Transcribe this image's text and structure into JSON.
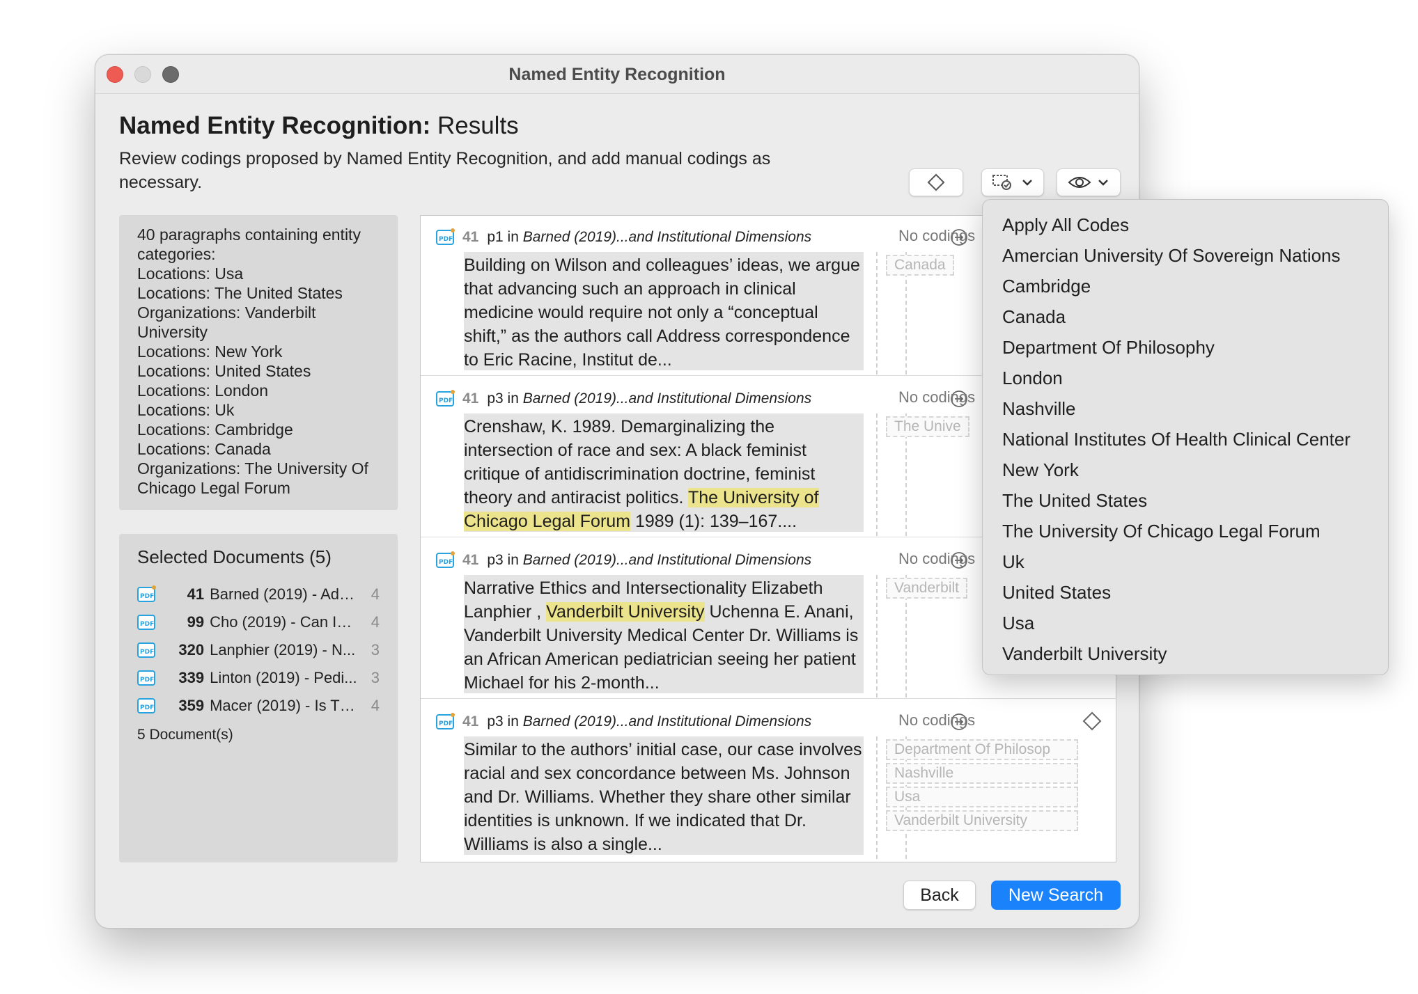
{
  "window": {
    "title": "Named Entity Recognition"
  },
  "header": {
    "title_bold": "Named Entity Recognition:",
    "title_rest": " Results",
    "subtitle": "Review codings proposed by Named Entity Recognition, and add manual codings as necessary."
  },
  "toolbar": {
    "icons": [
      "diamond-icon",
      "code-filter-icon",
      "eye-icon"
    ]
  },
  "summary": {
    "lines": [
      "40 paragraphs containing entity categories:",
      "Locations: Usa",
      "Locations: The United States",
      "Organizations: Vanderbilt University",
      "Locations: New York",
      "Locations: United States",
      "Locations: London",
      "Locations: Uk",
      "Locations: Cambridge",
      "Locations: Canada",
      "Organizations: The University Of Chicago  Legal Forum"
    ]
  },
  "documents": {
    "title": "Selected Documents (5)",
    "items": [
      {
        "num": "41",
        "title": "Barned (2019) - Add...",
        "count": "4"
      },
      {
        "num": "99",
        "title": "Cho (2019) - Can Int...",
        "count": "4"
      },
      {
        "num": "320",
        "title": "Lanphier (2019) - N...",
        "count": "3"
      },
      {
        "num": "339",
        "title": "Linton (2019) - Pedi...",
        "count": "3"
      },
      {
        "num": "359",
        "title": "Macer (2019) - Is Th...",
        "count": "4"
      }
    ],
    "footer": "5 Document(s)"
  },
  "paragraphs": [
    {
      "num": "41",
      "page": "p1 in ",
      "source": "Barned (2019)...and Institutional Dimensions",
      "codings_label": "No codings",
      "text_before": "Building on Wilson and colleagues’ ideas, we argue that  advancing such an approach in clinical medicine would  require not only a “conceptual shift,” as the authors call  Address correspondence to Eric Racine, Institut de...",
      "highlight": "",
      "text_after": "",
      "tags": [
        "Canada"
      ]
    },
    {
      "num": "41",
      "page": "p3 in ",
      "source": "Barned (2019)...and Institutional Dimensions",
      "codings_label": "No codings",
      "text_before": "Crenshaw, K. 1989. Demarginalizing the intersection of race and  sex: A black feminist critique of antidiscrimination doctrine,  feminist theory and antiracist politics. ",
      "highlight": "The University of Chicago  Legal Forum",
      "text_after": " 1989 (1): 139–167....",
      "tags": [
        "The Unive"
      ]
    },
    {
      "num": "41",
      "page": "p3 in ",
      "source": "Barned (2019)...and Institutional Dimensions",
      "codings_label": "No codings",
      "text_before": "Narrative Ethics and Intersectionality  Elizabeth Lanphier , ",
      "highlight": "Vanderbilt University",
      "text_after": "  Uchenna E. Anani, Vanderbilt University Medical Center  Dr. Williams is an African American pediatrician seeing  her patient Michael for his 2-month...",
      "tags": [
        "Vanderbilt"
      ]
    },
    {
      "num": "41",
      "page": "p3 in ",
      "source": "Barned (2019)...and Institutional Dimensions",
      "codings_label": "No codings",
      "text_before": "Similar to the authors’ initial case, our case involves  racial and sex concordance between Ms. Johnson and  Dr. Williams. Whether they share other similar identities  is unknown. If we indicated that Dr. Williams is also a  single...",
      "highlight": "",
      "text_after": "",
      "tags": [
        "Department Of Philosop",
        "Nashville",
        "Usa",
        "Vanderbilt University"
      ]
    }
  ],
  "dropdown": {
    "items": [
      "Apply All Codes",
      "Amercian University Of Sovereign Nations",
      "Cambridge",
      "Canada",
      "Department Of Philosophy",
      "London",
      "Nashville",
      "National Institutes Of Health Clinical Center",
      "New York",
      "The United States",
      "The University Of Chicago  Legal Forum",
      "Uk",
      "United States",
      "Usa",
      "Vanderbilt University"
    ]
  },
  "footer": {
    "back_label": "Back",
    "new_search_label": "New Search"
  },
  "colors": {
    "accent": "#1a82fb",
    "highlight": "#ece38d",
    "pdf_icon": "#29a3e0",
    "close": "#ee5b52"
  }
}
